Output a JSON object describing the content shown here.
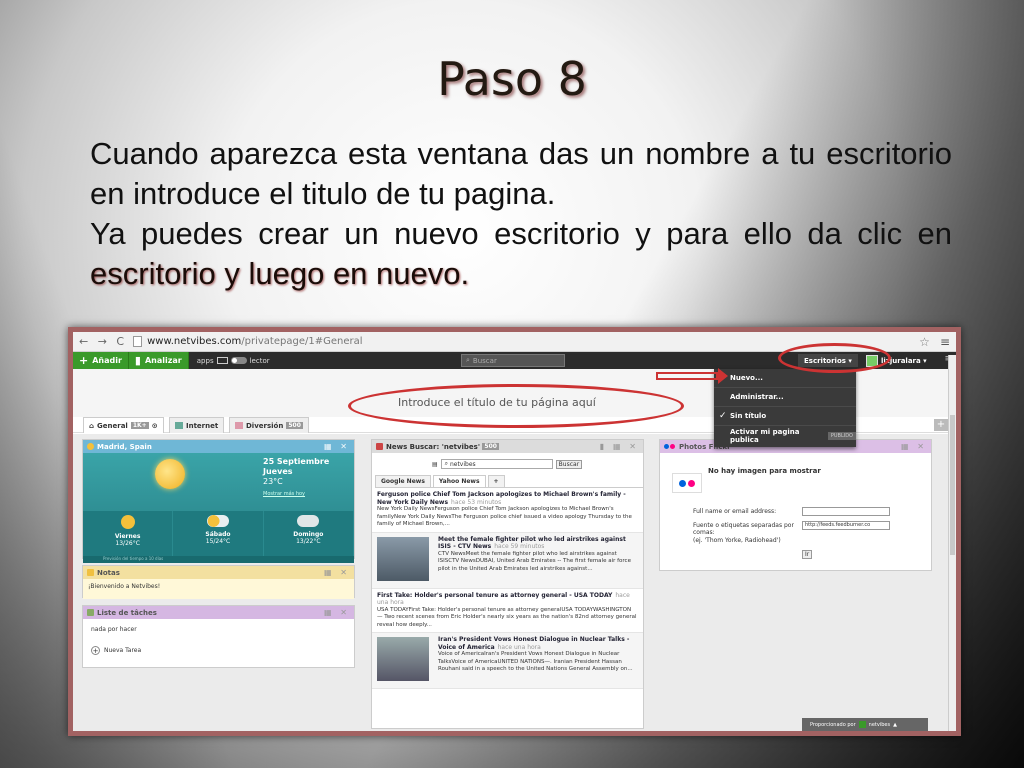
{
  "slide": {
    "title": "Paso 8",
    "paragraph1": "Cuando aparezca esta ventana das un nombre a tu escritorio en introduce el titulo de tu pagina.",
    "paragraph2_start": "Ya puedes crear un nuevo escritorio y para ello da clic en ",
    "paragraph2_highlight": "escritorio y luego en nuevo."
  },
  "browser": {
    "url_host": "www.netvibes.com",
    "url_path": "/privatepage/1#General",
    "nav_glyphs": "← → C"
  },
  "topbar": {
    "add_label": "Añadir",
    "analyze_label": "Analizar",
    "apps_label": "apps",
    "reader_label": "lector",
    "search_placeholder": "Buscar",
    "escritorios_label": "Escritorios ▾",
    "user_label": "lizjuralara ▾"
  },
  "dropdown": {
    "items": [
      "Nuevo...",
      "Administrar...",
      "Sin título",
      "Activar mi pagina publica"
    ],
    "public_badge": "PUBLIDO"
  },
  "page": {
    "title_placeholder": "Introduce el título de tu página aquí"
  },
  "tabs": [
    {
      "label": "General",
      "count": "1K+"
    },
    {
      "label": "Internet",
      "count": ""
    },
    {
      "label": "Diversión",
      "count": "500"
    }
  ],
  "weather": {
    "location": "Madrid, Spain",
    "date_line1": "25 Septiembre",
    "date_line2": "Jueves",
    "temp": "23°C",
    "more": "Mostrar más hoy",
    "days": [
      {
        "name": "Viernes",
        "temp": "13/26°C"
      },
      {
        "name": "Sábado",
        "temp": "15/24°C"
      },
      {
        "name": "Domingo",
        "temp": "13/22°C"
      }
    ],
    "footer": "Previsión del tiempo a 10 días"
  },
  "notas": {
    "title": "Notas",
    "body": "¡Bienvenido a Netvibes!"
  },
  "tareas": {
    "title": "Liste de tâches",
    "empty": "nada por hacer",
    "new_task": "Nueva Tarea"
  },
  "news": {
    "title": "News Buscar: 'netvibes'",
    "count": "500",
    "query": "netvibes",
    "search_btn": "Buscar",
    "tab_google": "Google News",
    "tab_yahoo": "Yahoo News",
    "tab_add": "+",
    "items": [
      {
        "headline": "Ferguson police Chief Tom Jackson apologizes to Michael Brown's family - New York Daily News",
        "ago": "hace 53 minutos",
        "text": "New York Daily NewsFerguson police Chief Tom Jackson apologizes to Michael Brown's familyNew York Daily NewsThe Ferguson police chief issued a video apology Thursday to the family of Michael Brown,..."
      },
      {
        "headline": "Meet the female fighter pilot who led airstrikes against ISIS - CTV News",
        "ago": "hace 59 minutos",
        "text": "CTV NewsMeet the female fighter pilot who led airstrikes against ISISCTV NewsDUBAI, United Arab Emirates -- The first female air force pilot in the United Arab Emirates led airstrikes against..."
      },
      {
        "headline": "First Take: Holder's personal tenure as attorney general - USA TODAY",
        "ago": "hace una hora",
        "text": "USA TODAYFirst Take: Holder's personal tenure as attorney generalUSA TODAYWASHINGTON — Two recent scenes from Eric Holder's nearly six years as the nation's 82nd attorney general reveal how deeply..."
      },
      {
        "headline": "Iran's President Vows Honest Dialogue in Nuclear Talks - Voice of America",
        "ago": "hace una hora",
        "text": "Voice of AmericaIran's President Vows Honest Dialogue in Nuclear TalksVoice of AmericaUNITED NATIONS—. Iranian President Hassan Rouhani said in a speech to the United Nations General Assembly on..."
      }
    ]
  },
  "flickr": {
    "title": "Photos Flickr",
    "no_image": "No hay imagen para mostrar",
    "label_name": "Full name or email address:",
    "label_source1": "Fuente o etiquetas separadas por",
    "label_source2": "comas:",
    "label_example": "(ej. 'Thom Yorke, Radiohead')",
    "source_value": "http://feeds.feedburner.co",
    "go_btn": "Ir"
  },
  "footer": {
    "provided_by": "Proporcionado por",
    "brand": "netvibes"
  },
  "colors": {
    "accent_green": "#3a9a2a",
    "annotation_red": "#cc3333"
  }
}
